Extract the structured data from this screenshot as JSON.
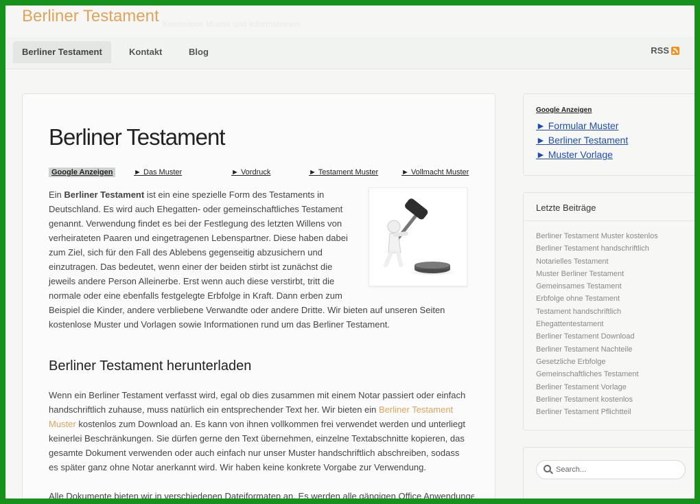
{
  "header": {
    "site_title": "Berliner Testament",
    "tagline": "Kostenlose Muster und Informationen"
  },
  "nav": {
    "items": [
      {
        "label": "Berliner Testament"
      },
      {
        "label": "Kontakt"
      },
      {
        "label": "Blog"
      }
    ],
    "rss_label": "RSS"
  },
  "post": {
    "title": "Berliner Testament",
    "ads": {
      "label": "Google Anzeigen",
      "links": [
        "► Das Muster",
        "► Vordruck",
        "► Testament Muster",
        "► Vollmacht Muster"
      ]
    },
    "intro": {
      "pre": "Ein ",
      "bold": "Berliner Testament",
      "rest": " ist ein eine spezielle Form des Testaments in Deutschland. Es wird auch Ehegatten- oder gemeinschaftliches Testament genannt. Verwendung findet es bei der Festlegung des letzten Willens von verheirateten Paaren und eingetragenen Lebenspartner. Diese haben dabei zum Ziel, sich für den Fall des Ablebens gegenseitig abzusichern und einzutragen. Das bedeutet, wenn einer der beiden stirbt ist zunächst die jeweils andere Person Alleinerbe. Erst wenn auch diese verstirbt, tritt die normale oder eine ebenfalls festgelegte Erbfolge in Kraft. Dann erben zum Beispiel die Kinder, andere verbliebene Verwandte oder andere Dritte. Wir bieten auf unseren Seiten kostenlose Muster und Vorlagen sowie Informationen rund um das Berliner Testament."
    },
    "heading2": "Berliner Testament herunterladen",
    "p2": {
      "pre": "Wenn ein Berliner Testament verfasst wird, egal ob dies zusammen mit einem Notar passiert oder einfach handschriftlich zuhause, muss natürlich ein entsprechender Text her. Wir bieten ein ",
      "link": "Berliner Testament Muster",
      "rest": " kostenlos zum Download an. Es kann von ihnen vollkommen frei verwendet werden und unterliegt keinerlei Beschränkungen. Sie dürfen gerne den Text übernehmen, einzelne Textabschnitte kopieren, das gesamte Dokument verwenden oder auch einfach nur unser Muster handschriftlich abschreiben, sodass es später ganz ohne Notar anerkannt wird. Wir haben keine konkrete Vorgabe zur Verwendung."
    },
    "p3": "Alle Dokumente bieten wir in verschiedenen Dateiformaten an. Es werden alle gängigen Office Anwendungen"
  },
  "sidebar": {
    "ads": {
      "title": "Google Anzeigen",
      "links": [
        "► Formular Muster",
        "► Berliner Testament",
        "► Muster Vorlage"
      ]
    },
    "recent": {
      "title": "Letzte Beiträge",
      "items": [
        "Berliner Testament Muster kostenlos",
        "Berliner Testament handschriftlich",
        "Notarielles Testament",
        "Muster Berliner Testament",
        "Gemeinsames Testament",
        "Erbfolge ohne Testament",
        "Testament handschriftlich",
        "Ehegattentestament",
        "Berliner Testament Download",
        "Berliner Testament Nachteile",
        "Gesetzliche Erbfolge",
        "Gemeinschaftliches Testament",
        "Berliner Testament Vorlage",
        "Berliner Testament kostenlos",
        "Berliner Testament Pflichtteil"
      ]
    },
    "search": {
      "placeholder": "Search..."
    }
  },
  "colors": {
    "frame": "#16911c",
    "accent": "#e0a35c",
    "ad_link": "#1f4bb5"
  }
}
